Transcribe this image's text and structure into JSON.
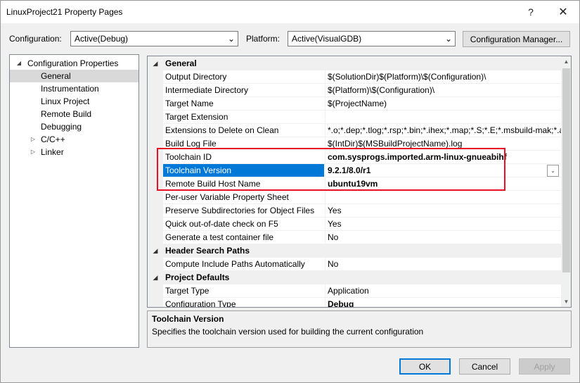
{
  "window": {
    "title": "LinuxProject21 Property Pages",
    "help_glyph": "?",
    "close_glyph": "✕"
  },
  "toolbar": {
    "configuration_label": "Configuration:",
    "configuration_value": "Active(Debug)",
    "platform_label": "Platform:",
    "platform_value": "Active(VisualGDB)",
    "manager_button": "Configuration Manager..."
  },
  "tree": {
    "root": "Configuration Properties",
    "items": [
      {
        "label": "General",
        "selected": true
      },
      {
        "label": "Instrumentation"
      },
      {
        "label": "Linux Project"
      },
      {
        "label": "Remote Build"
      },
      {
        "label": "Debugging"
      },
      {
        "label": "C/C++",
        "expandable": true
      },
      {
        "label": "Linker",
        "expandable": true
      }
    ]
  },
  "grid": {
    "categories": {
      "general": "General",
      "header": "Header Search Paths",
      "defaults": "Project Defaults"
    },
    "general_rows": [
      {
        "name": "Output Directory",
        "value": "$(SolutionDir)$(Platform)\\$(Configuration)\\"
      },
      {
        "name": "Intermediate Directory",
        "value": "$(Platform)\\$(Configuration)\\"
      },
      {
        "name": "Target Name",
        "value": "$(ProjectName)"
      },
      {
        "name": "Target Extension",
        "value": ""
      },
      {
        "name": "Extensions to Delete on Clean",
        "value": "*.o;*.dep;*.tlog;*.rsp;*.bin;*.ihex;*.map;*.S;*.E;*.msbuild-mak;*.a"
      },
      {
        "name": "Build Log File",
        "value": "$(IntDir)$(MSBuildProjectName).log"
      },
      {
        "name": "Toolchain ID",
        "value": "com.sysprogs.imported.arm-linux-gnueabihf"
      },
      {
        "name": "Toolchain Version",
        "value": "9.2.1/8.0/r1"
      },
      {
        "name": "Remote Build Host Name",
        "value": "ubuntu19vm"
      },
      {
        "name": "Per-user Variable Property Sheet",
        "value": ""
      },
      {
        "name": "Preserve Subdirectories for Object Files",
        "value": "Yes"
      },
      {
        "name": "Quick out-of-date check on F5",
        "value": "Yes"
      },
      {
        "name": "Generate a test container file",
        "value": "No"
      }
    ],
    "header_rows": [
      {
        "name": "Compute Include Paths Automatically",
        "value": "No"
      }
    ],
    "defaults_rows": [
      {
        "name": "Target Type",
        "value": "Application"
      },
      {
        "name": "Configuration Type",
        "value": "Debug"
      }
    ]
  },
  "description": {
    "title": "Toolchain Version",
    "text": "Specifies the toolchain version used for building the current configuration"
  },
  "buttons": {
    "ok": "OK",
    "cancel": "Cancel",
    "apply": "Apply"
  },
  "icons": {
    "combo_arrow": "⌄",
    "expanded": "◢",
    "collapsed": "▷",
    "scroll_up": "▲",
    "scroll_down": "▼"
  }
}
